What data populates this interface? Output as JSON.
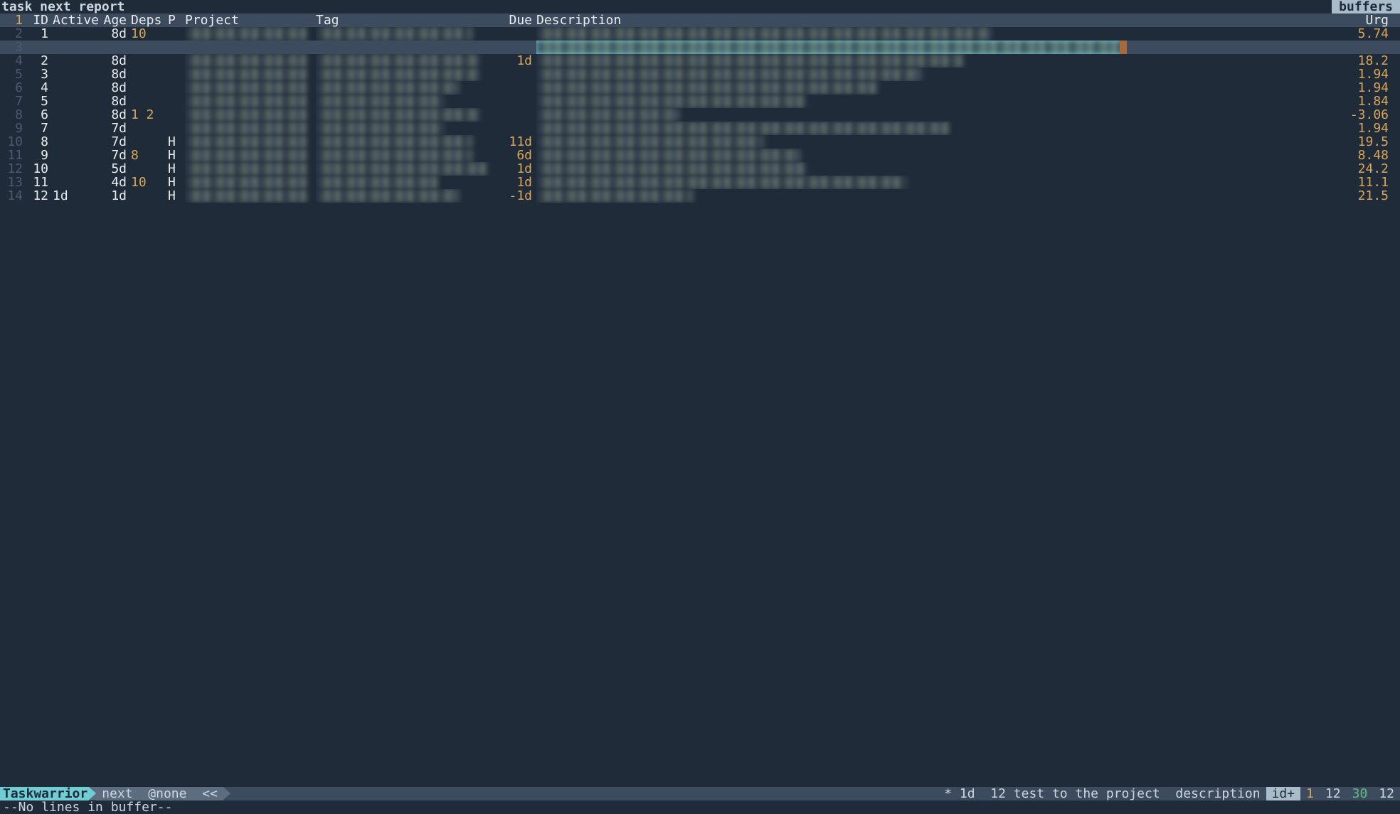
{
  "title": "task next report",
  "tab_label": "buffers",
  "columns": {
    "lineno": "",
    "id": "ID",
    "active": "Active",
    "age": "Age",
    "deps": "Deps",
    "p": "P",
    "project": "Project",
    "tag": "Tag",
    "due": "Due",
    "desc": "Description",
    "urg": "Urg"
  },
  "header_lineno": "1",
  "rows": [
    {
      "lineno": "2",
      "id": "1",
      "active": "",
      "age": "8d",
      "deps": "10",
      "p": "",
      "due": "",
      "urg": "5.74",
      "highlight": false,
      "proj_blur": 170,
      "tag_blur": 220,
      "desc_blur": 640
    },
    {
      "lineno": "3",
      "id": "",
      "active": "",
      "age": "",
      "deps": "",
      "p": "",
      "due": "",
      "urg": "",
      "highlight": true,
      "proj_blur": 0,
      "tag_blur": 0,
      "desc_blur": 830
    },
    {
      "lineno": "4",
      "id": "2",
      "active": "",
      "age": "8d",
      "deps": "",
      "p": "",
      "due": "1d",
      "urg": "18.2",
      "highlight": false,
      "proj_blur": 170,
      "tag_blur": 230,
      "desc_blur": 600
    },
    {
      "lineno": "5",
      "id": "3",
      "active": "",
      "age": "8d",
      "deps": "",
      "p": "",
      "due": "",
      "urg": "1.94",
      "highlight": false,
      "proj_blur": 170,
      "tag_blur": 230,
      "desc_blur": 540
    },
    {
      "lineno": "6",
      "id": "4",
      "active": "",
      "age": "8d",
      "deps": "",
      "p": "",
      "due": "",
      "urg": "1.94",
      "highlight": false,
      "proj_blur": 170,
      "tag_blur": 200,
      "desc_blur": 480
    },
    {
      "lineno": "7",
      "id": "5",
      "active": "",
      "age": "8d",
      "deps": "",
      "p": "",
      "due": "",
      "urg": "1.84",
      "highlight": false,
      "proj_blur": 170,
      "tag_blur": 180,
      "desc_blur": 380
    },
    {
      "lineno": "8",
      "id": "6",
      "active": "",
      "age": "8d",
      "deps": "1 2",
      "p": "",
      "due": "",
      "urg": "-3.06",
      "highlight": false,
      "proj_blur": 170,
      "tag_blur": 230,
      "desc_blur": 200
    },
    {
      "lineno": "9",
      "id": "7",
      "active": "",
      "age": "7d",
      "deps": "",
      "p": "",
      "due": "",
      "urg": "1.94",
      "highlight": false,
      "proj_blur": 170,
      "tag_blur": 180,
      "desc_blur": 580
    },
    {
      "lineno": "10",
      "id": "8",
      "active": "",
      "age": "7d",
      "deps": "",
      "p": "H",
      "due": "11d",
      "urg": "19.5",
      "highlight": false,
      "proj_blur": 170,
      "tag_blur": 220,
      "desc_blur": 320
    },
    {
      "lineno": "11",
      "id": "9",
      "active": "",
      "age": "7d",
      "deps": "8",
      "p": "H",
      "due": "6d",
      "urg": "8.48",
      "highlight": false,
      "proj_blur": 170,
      "tag_blur": 220,
      "desc_blur": 370
    },
    {
      "lineno": "12",
      "id": "10",
      "active": "",
      "age": "5d",
      "deps": "",
      "p": "H",
      "due": "1d",
      "urg": "24.2",
      "highlight": false,
      "proj_blur": 170,
      "tag_blur": 240,
      "desc_blur": 380
    },
    {
      "lineno": "13",
      "id": "11",
      "active": "",
      "age": "4d",
      "deps": "10",
      "p": "H",
      "due": "1d",
      "urg": "11.1",
      "highlight": false,
      "proj_blur": 170,
      "tag_blur": 170,
      "desc_blur": 520
    },
    {
      "lineno": "14",
      "id": "12",
      "active": "1d",
      "age": "1d",
      "deps": "",
      "p": "H",
      "due": "-1d",
      "urg": "21.5",
      "highlight": false,
      "proj_blur": 170,
      "tag_blur": 200,
      "desc_blur": 220
    }
  ],
  "status": {
    "app": "Taskwarrior",
    "report": "next",
    "context": "@none",
    "chevrons": "<<",
    "right_text": "* 1d  12 test to the project  description",
    "sort": "id+",
    "n1": "1",
    "n2": "12",
    "n3": "30",
    "n4": "12"
  },
  "cmdline": "--No lines in buffer--"
}
